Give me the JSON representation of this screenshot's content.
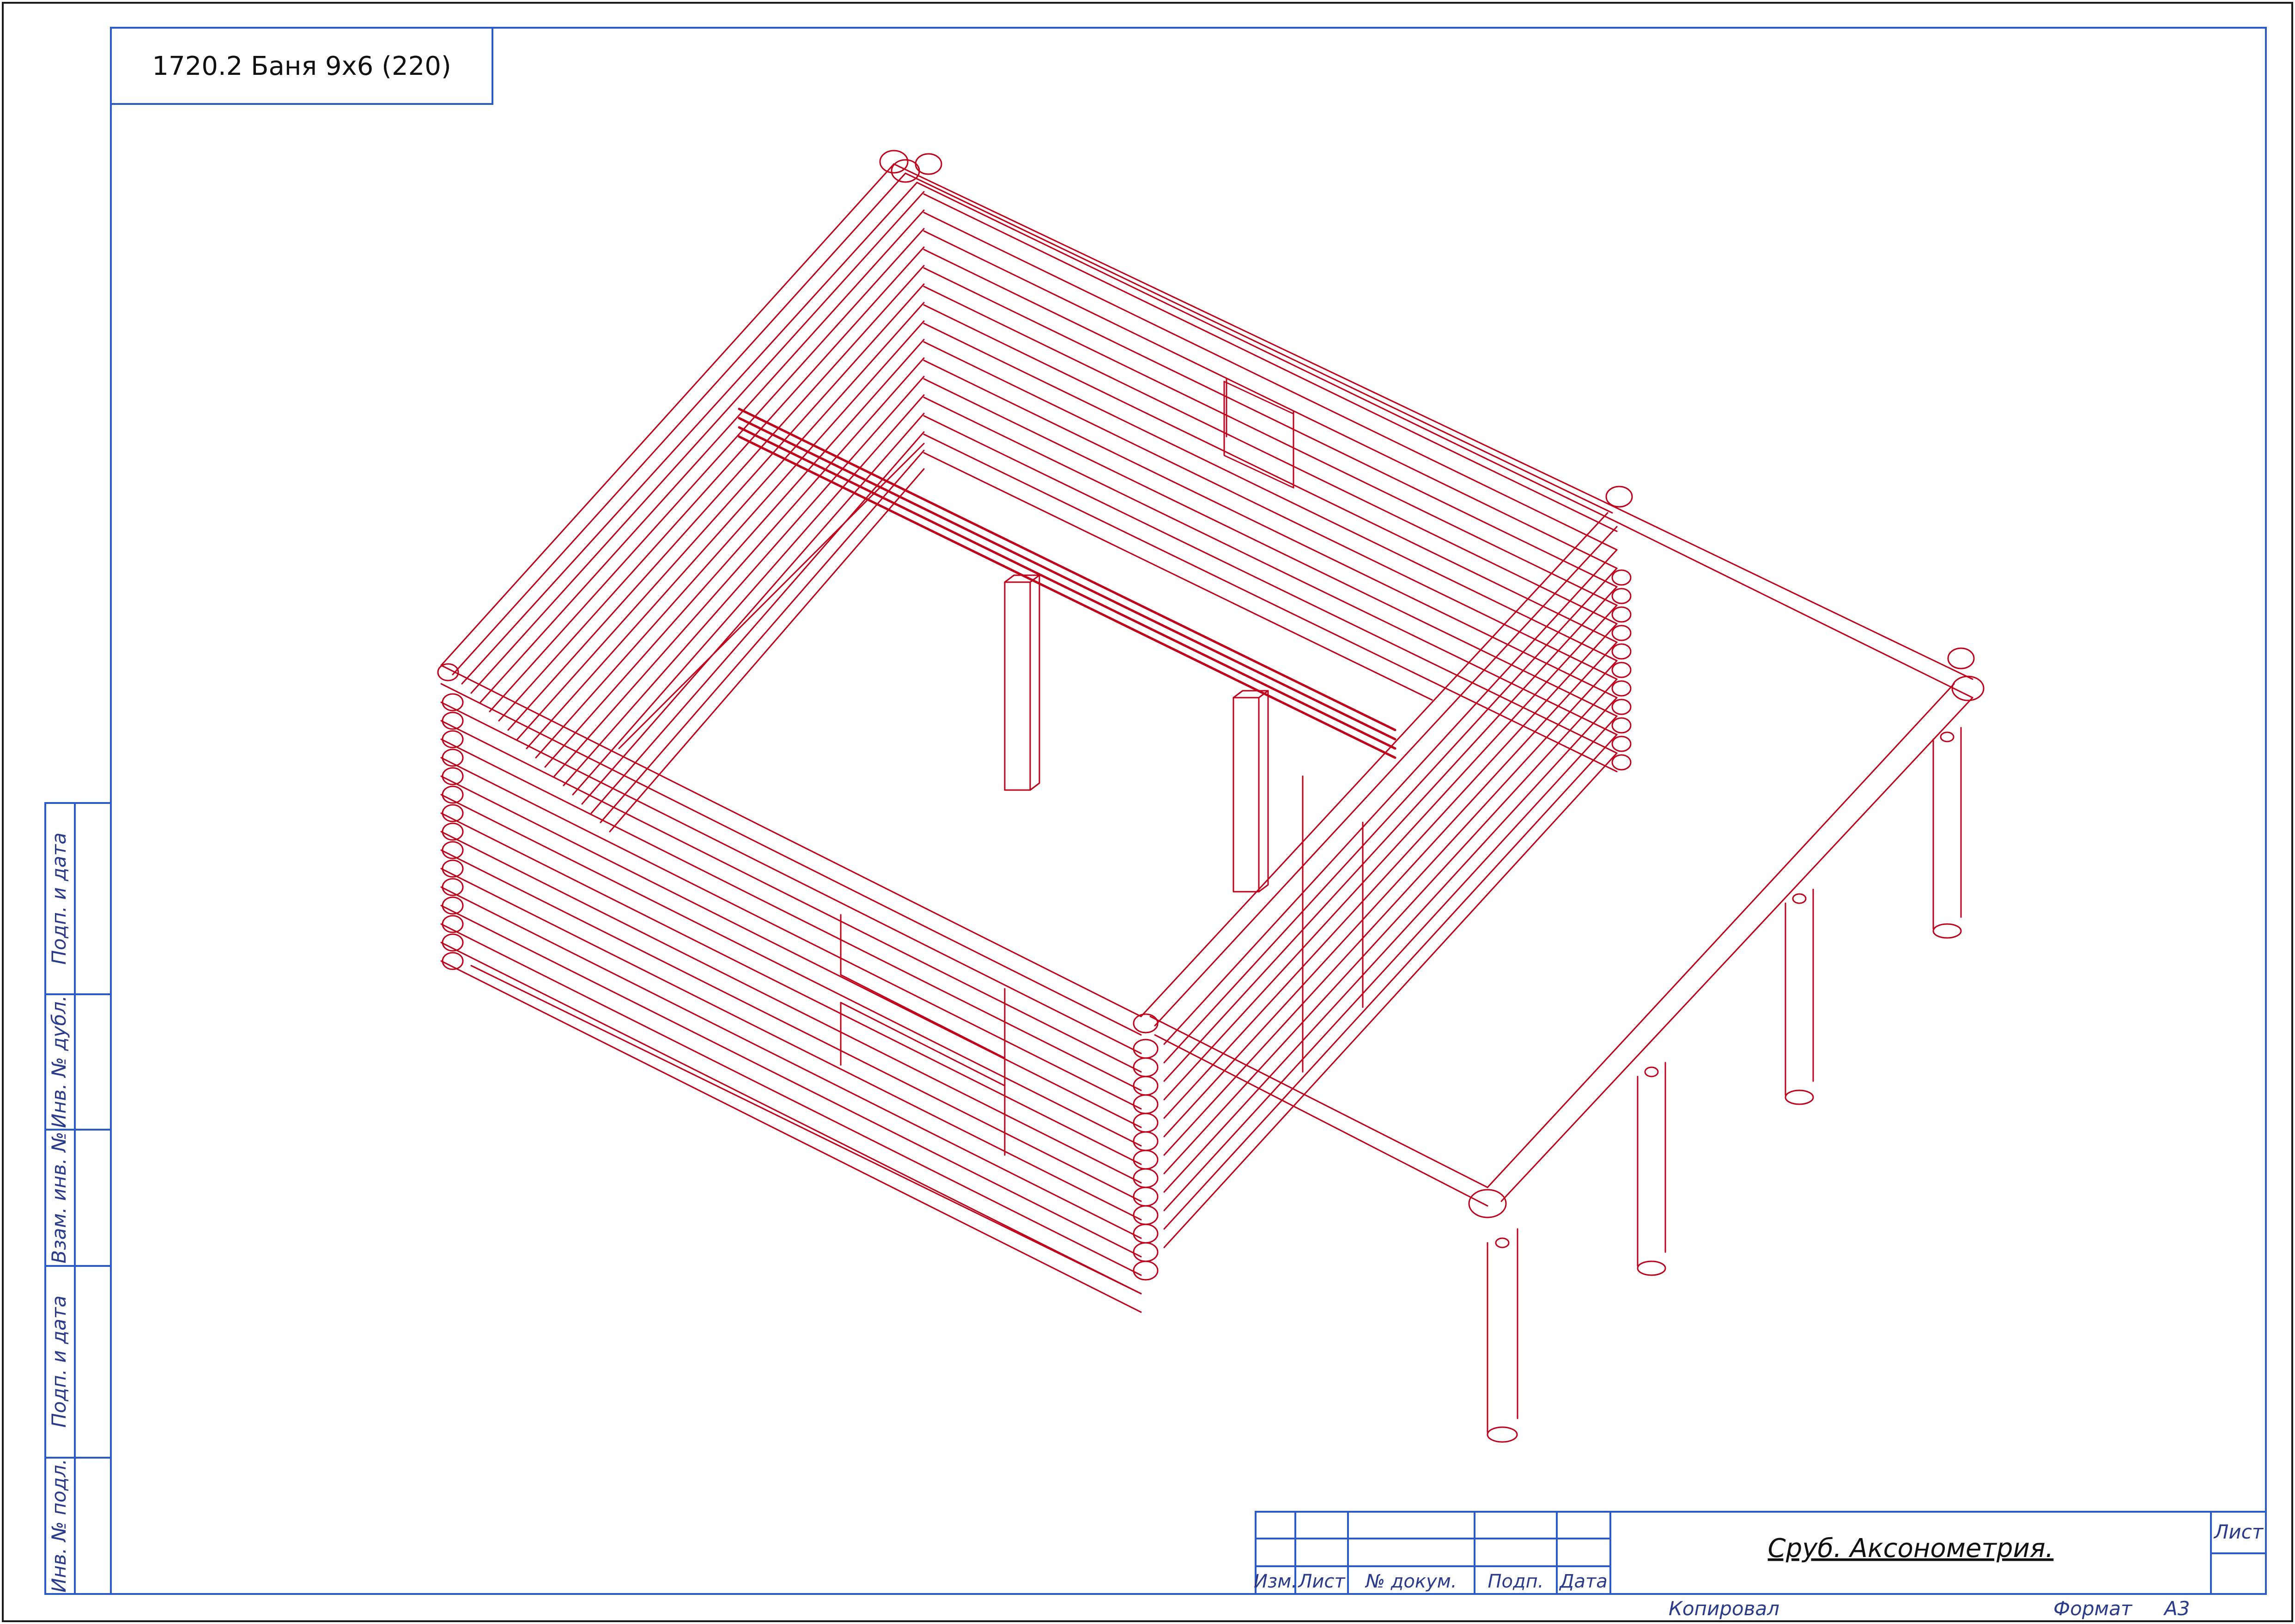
{
  "project_label": "1720.2 Баня 9х6 (220)",
  "side_stamp": {
    "cells": [
      "Подп. и дата",
      "Инв. № дубл.",
      "Взам. инв. №",
      "Подп. и дата",
      "Инв. № подл."
    ]
  },
  "title_block": {
    "headers": [
      "Изм.",
      "Лист",
      "№ докум.",
      "Подп.",
      "Дата"
    ],
    "drawing_title": "Сруб. Аксонометрия.",
    "sheet_label": "Лист"
  },
  "footer": {
    "copied_by": "Копировал",
    "format_label": "Формат",
    "format_value": "А3"
  },
  "colors": {
    "frame": "#1a1a1a",
    "stamp_lines": "#2a5bc8",
    "drawing_lines": "#c0001a"
  }
}
